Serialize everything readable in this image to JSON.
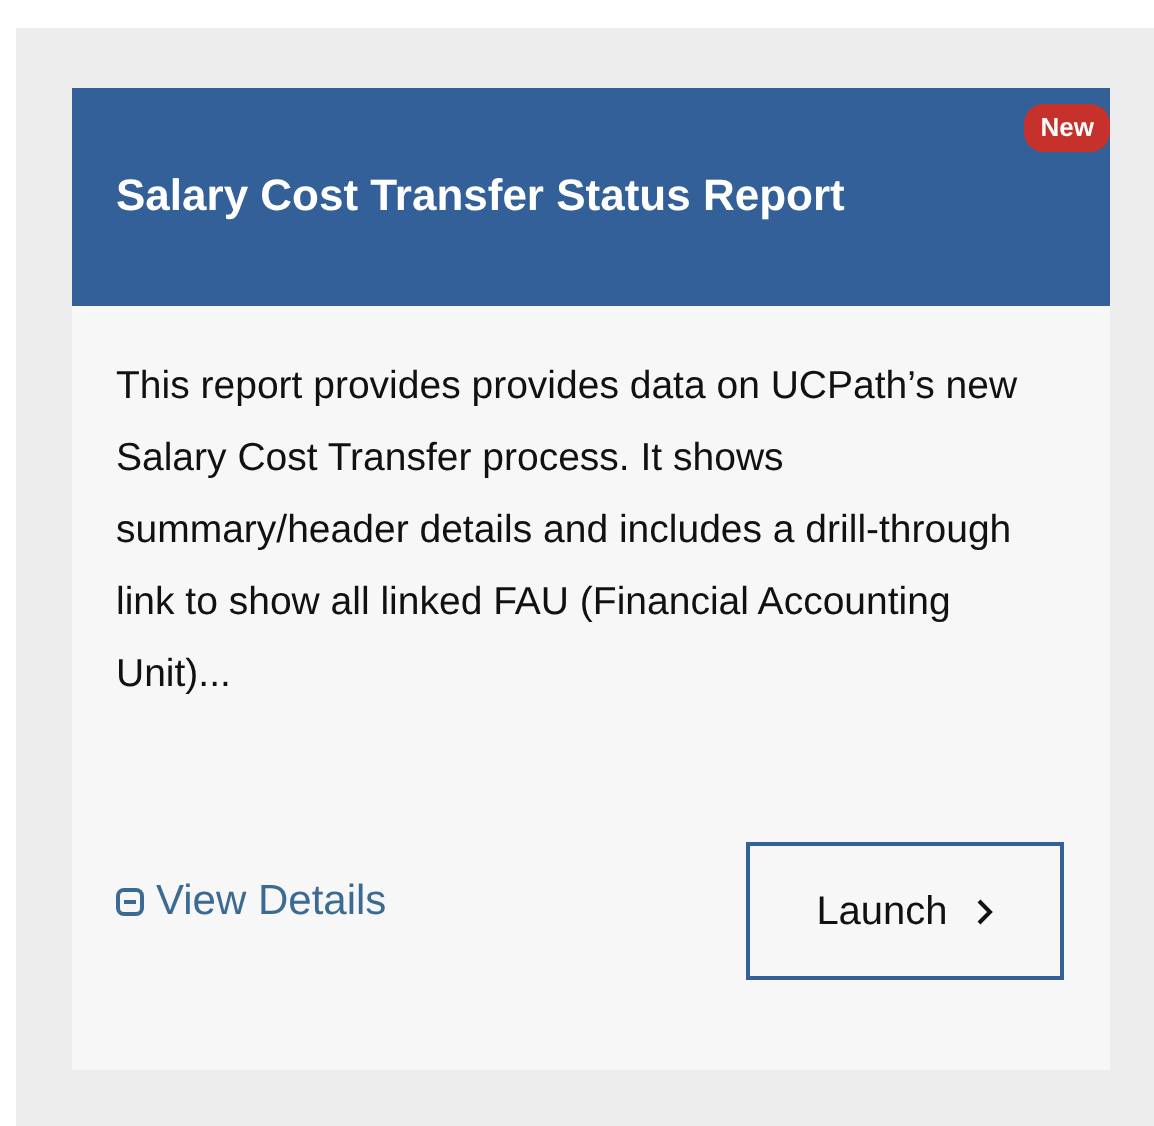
{
  "card": {
    "title": "Salary Cost Transfer Status Report",
    "badge": "New",
    "description": "This report provides provides data on UCPath’s new Salary Cost Transfer process. It shows summary/header details and includes a drill-through link to show all linked FAU (Financial Accounting Unit)...",
    "details_link": "View Details",
    "launch_button": "Launch"
  }
}
